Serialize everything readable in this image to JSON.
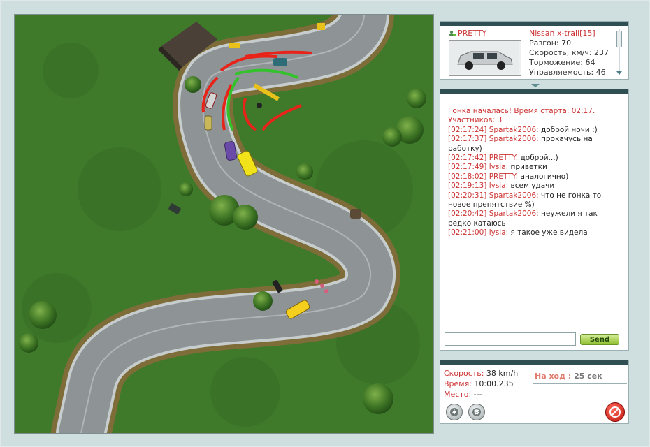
{
  "car_panel": {
    "player_name": "PRETTY",
    "car_name": "Nissan x-trail[15]",
    "stats": [
      "Разгон: 70",
      "Скорость, км/ч: 237",
      "Торможение: 64",
      "Управляемость: 46"
    ]
  },
  "chat": {
    "system_lines": [
      "Гонка началась! Время старта: 02:17.",
      "Участников: 3"
    ],
    "messages": [
      {
        "time": "[02:17:24]",
        "user": "Spartak2006:",
        "text": " доброй ночи :)"
      },
      {
        "time": "[02:17:37]",
        "user": "Spartak2006:",
        "text": " прокачусь на работку)"
      },
      {
        "time": "[02:17:42]",
        "user": "PRETTY:",
        "text": " доброй...)"
      },
      {
        "time": "[02:17:49]",
        "user": "lysia:",
        "text": " приветки"
      },
      {
        "time": "[02:18:02]",
        "user": "PRETTY:",
        "text": " аналогично)"
      },
      {
        "time": "[02:19:13]",
        "user": "lysia:",
        "text": " всем удачи"
      },
      {
        "time": "[02:20:31]",
        "user": "Spartak2006:",
        "text": " что не гонка то новое препятствие %)"
      },
      {
        "time": "[02:20:42]",
        "user": "Spartak2006:",
        "text": " неужели я так редко катаюсь"
      },
      {
        "time": "[02:21:00]",
        "user": "lysia:",
        "text": " я такое уже видела"
      }
    ],
    "input_value": "",
    "send_label": "Send"
  },
  "status": {
    "speed_label": "Скорость:",
    "speed_value": " 38 km/h",
    "time_label": "Время:",
    "time_value": " 10:00.235",
    "place_label": "Место:",
    "place_value": " ---",
    "turn_label": "На ход :",
    "turn_value": " 25 сек"
  },
  "colors": {
    "accent_red": "#cc3333",
    "panel_header": "#2f4f52",
    "grass": "#3f7a2b",
    "road": "#8e9496",
    "send_green": "#8fbf2f"
  }
}
